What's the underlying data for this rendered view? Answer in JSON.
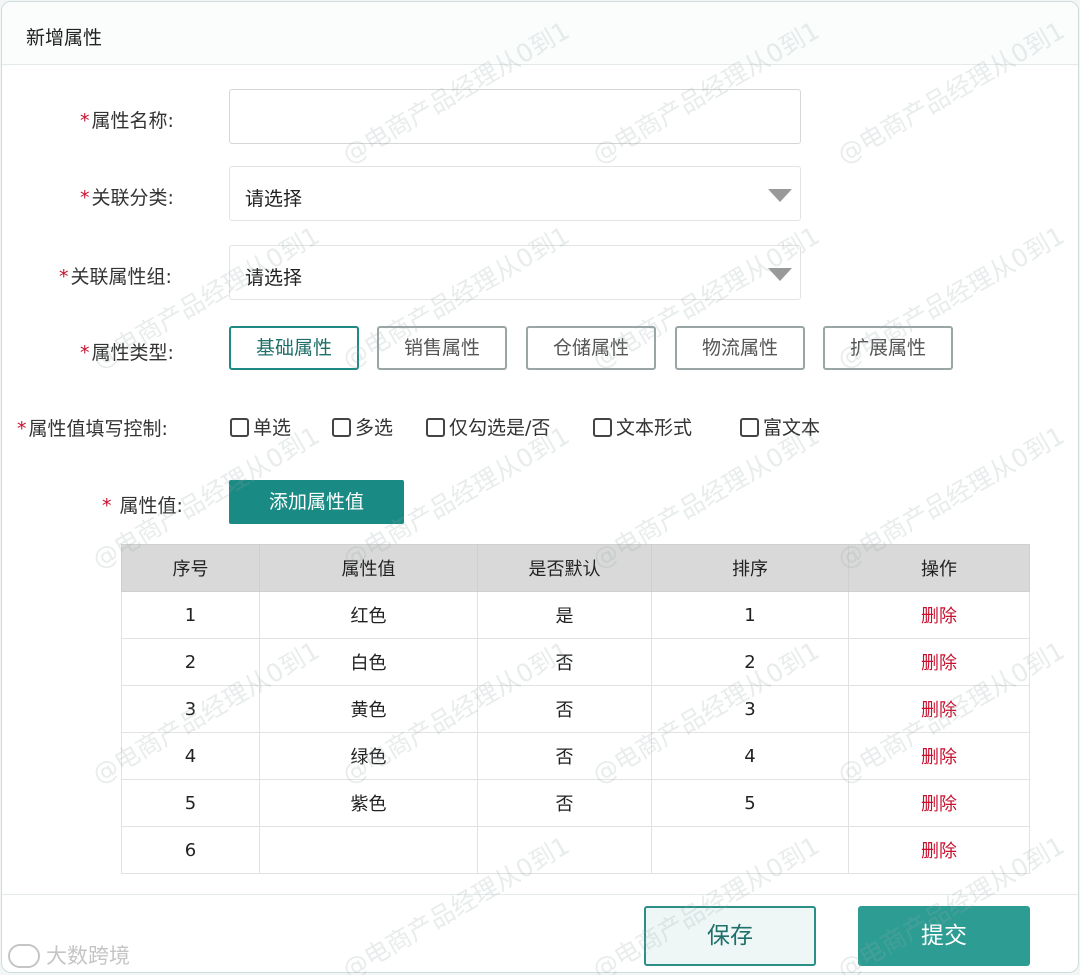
{
  "dialog": {
    "title": "新增属性"
  },
  "form": {
    "required_mark": "*",
    "name": {
      "label": "属性名称:",
      "value": ""
    },
    "category": {
      "label": "关联分类:",
      "value": "请选择"
    },
    "group": {
      "label": "关联属性组:",
      "value": "请选择"
    },
    "type": {
      "label": "属性类型:",
      "options": [
        "基础属性",
        "销售属性",
        "仓储属性",
        "物流属性",
        "扩展属性"
      ],
      "selected": "基础属性"
    },
    "control": {
      "label": "属性值填写控制:",
      "options": [
        "单选",
        "多选",
        "仅勾选是/否",
        "文本形式",
        "富文本"
      ]
    },
    "values": {
      "label": "属性值:",
      "add_button": "添加属性值"
    }
  },
  "table": {
    "columns": [
      "序号",
      "属性值",
      "是否默认",
      "排序",
      "操作"
    ],
    "rows": [
      {
        "index": "1",
        "value": "红色",
        "default": "是",
        "sort": "1",
        "action": "删除"
      },
      {
        "index": "2",
        "value": "白色",
        "default": "否",
        "sort": "2",
        "action": "删除"
      },
      {
        "index": "3",
        "value": "黄色",
        "default": "否",
        "sort": "3",
        "action": "删除"
      },
      {
        "index": "4",
        "value": "绿色",
        "default": "否",
        "sort": "4",
        "action": "删除"
      },
      {
        "index": "5",
        "value": "紫色",
        "default": "否",
        "sort": "5",
        "action": "删除"
      },
      {
        "index": "6",
        "value": "",
        "default": "",
        "sort": "",
        "action": "删除"
      }
    ]
  },
  "footer": {
    "save": "保存",
    "submit": "提交"
  },
  "watermark": {
    "text": "@电商产品经理从0到1",
    "brand": "大数跨境"
  },
  "colors": {
    "accent": "#1a8a84",
    "danger": "#c8102e",
    "header_bg": "#d9d9d9"
  }
}
